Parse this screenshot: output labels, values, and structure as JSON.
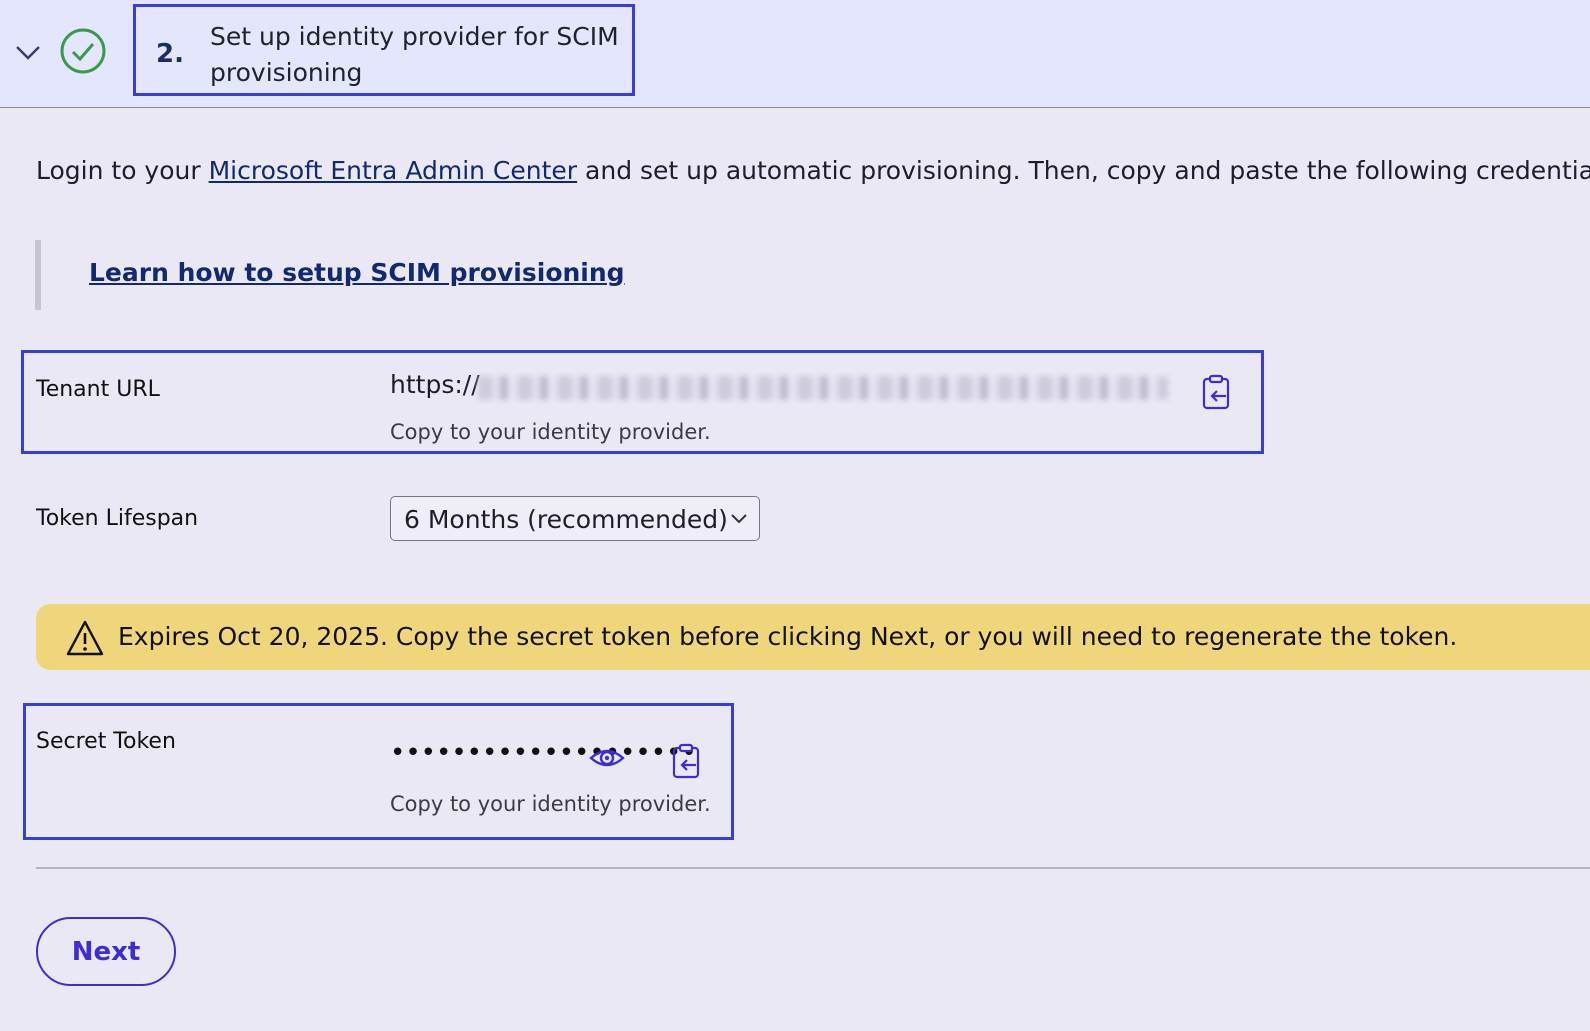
{
  "header": {
    "step_number": "2.",
    "step_title": "Set up identity provider for SCIM provisioning",
    "collapse_icon": "chevron-down-icon",
    "status_icon": "check-circle-icon",
    "status_color": "#3a9a4c",
    "accent_color": "#3b3ed6"
  },
  "intro": {
    "prefix": "Login to your ",
    "link_label": "Microsoft Entra Admin Center",
    "suffix": " and set up automatic provisioning. Then, copy and paste the following credentials."
  },
  "learn_link": "Learn how to setup SCIM provisioning",
  "tenant_url": {
    "label": "Tenant URL",
    "value": "https://",
    "help": "Copy to your identity provider.",
    "copy_icon": "clipboard-copy-icon"
  },
  "token_lifespan": {
    "label": "Token Lifespan",
    "selected": "6 Months (recommended)"
  },
  "warning": {
    "icon": "warning-icon",
    "text": "Expires Oct 20, 2025. Copy the secret token before clicking Next, or you will need to regenerate the token.",
    "color": "#f0d67a"
  },
  "secret_token": {
    "label": "Secret Token",
    "masked_value": "••••••••••••••••••••",
    "help": "Copy to your identity provider.",
    "reveal_icon": "eye-icon",
    "copy_icon": "clipboard-copy-icon"
  },
  "next_button": "Next"
}
